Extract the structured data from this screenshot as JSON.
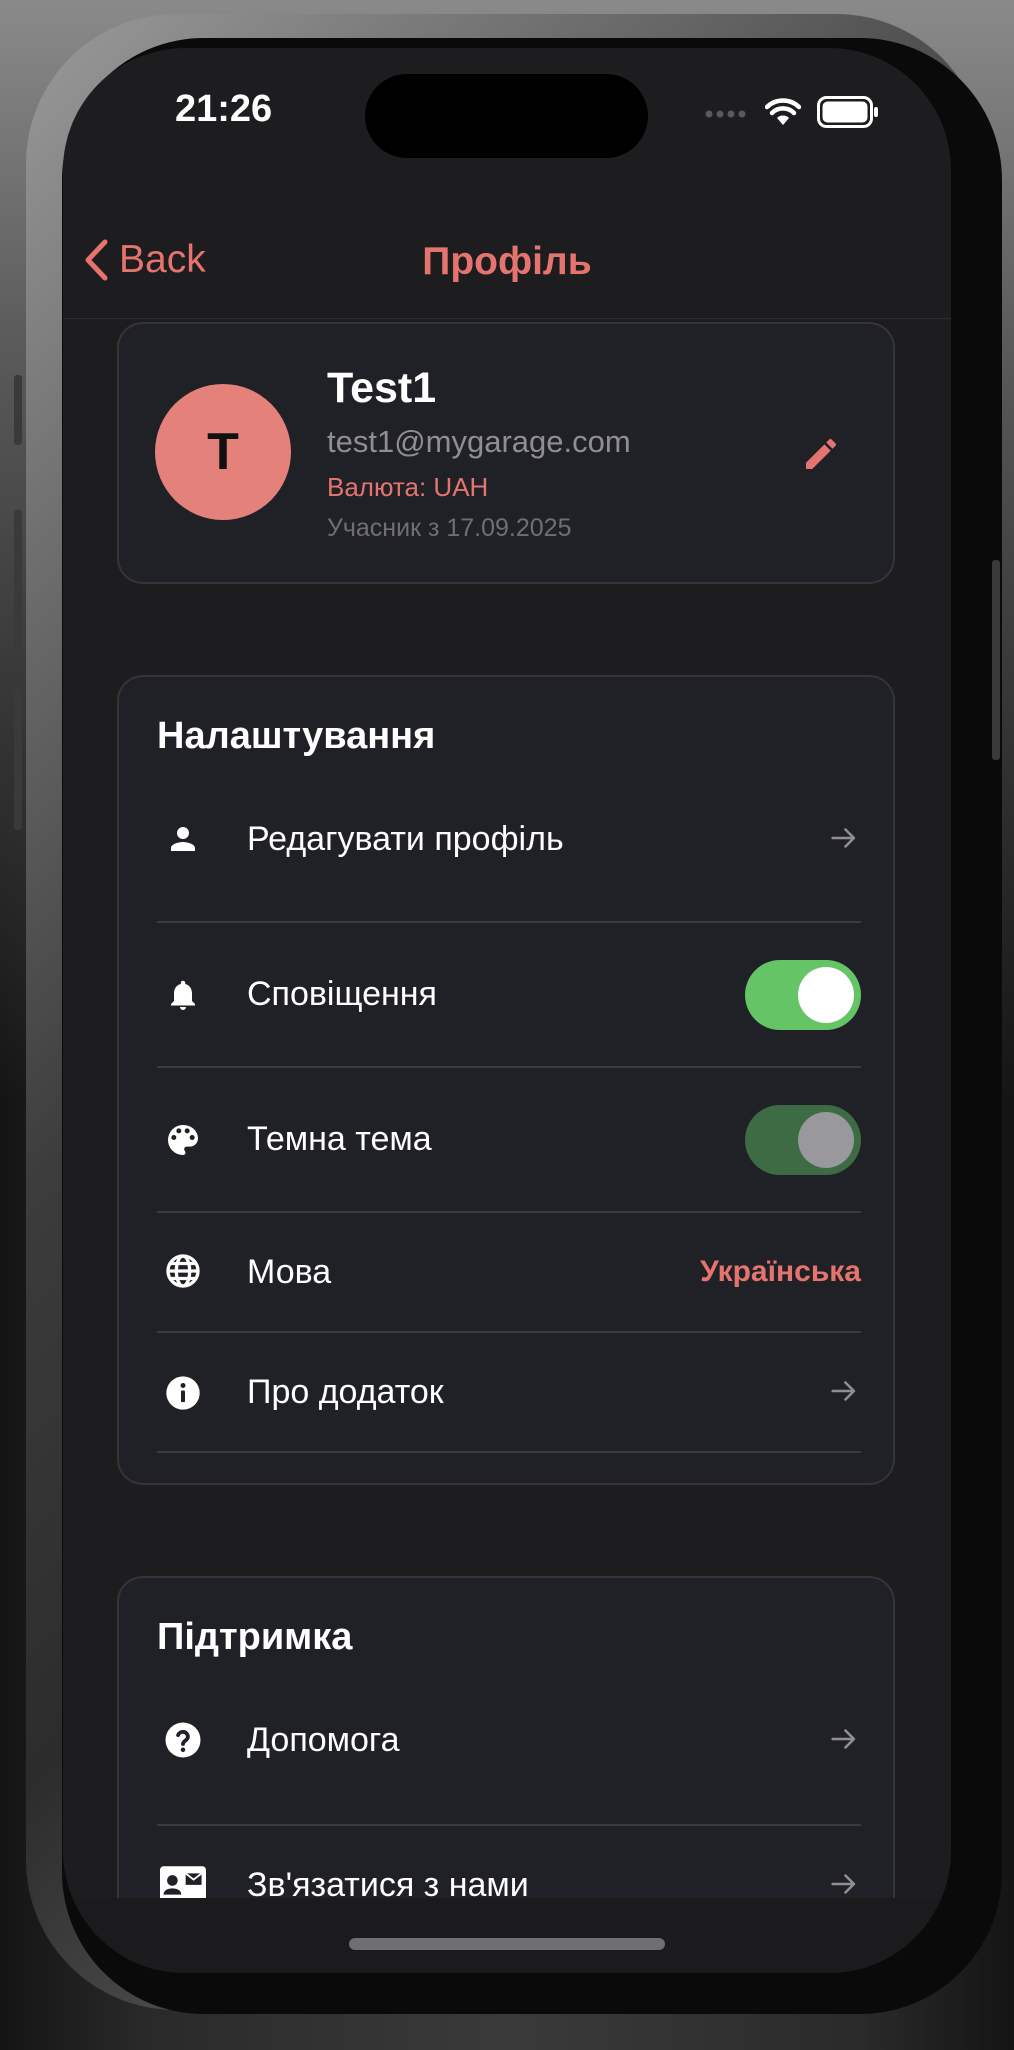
{
  "status_bar": {
    "time": "21:26"
  },
  "nav": {
    "back_label": "Back",
    "title": "Профіль"
  },
  "profile": {
    "initial": "T",
    "name": "Test1",
    "email": "test1@mygarage.com",
    "currency": "Валюта: UAH",
    "member_since": "Учасник з 17.09.2025"
  },
  "settings": {
    "title": "Налаштування",
    "edit_profile": "Редагувати профіль",
    "notifications": "Сповіщення",
    "dark_theme": "Темна тема",
    "language_label": "Мова",
    "language_value": "Українська",
    "about": "Про додаток"
  },
  "support": {
    "title": "Підтримка",
    "help": "Допомога",
    "contact": "Зв'язатися з нами"
  },
  "toggles": {
    "notifications_on": true,
    "dark_theme_on": true
  },
  "colors": {
    "accent": "#e5746f",
    "toggle_on": "#65c466",
    "toggle_dim": "#3d6b43",
    "card": "#202126",
    "background": "#1d1d20"
  },
  "icons": [
    "chevron-left-icon",
    "pencil-icon",
    "person-icon",
    "bell-icon",
    "palette-icon",
    "globe-icon",
    "info-icon",
    "arrow-right-icon",
    "help-icon",
    "contact-card-icon",
    "wifi-icon",
    "battery-icon",
    "signal-icon"
  ]
}
